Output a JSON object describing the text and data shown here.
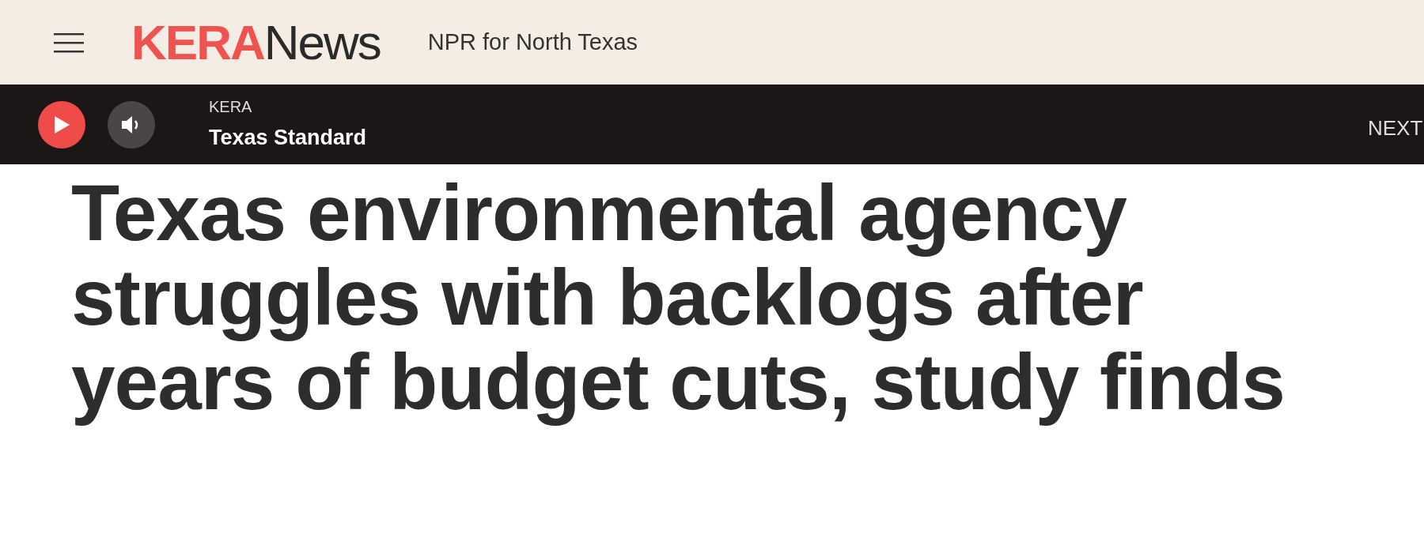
{
  "header": {
    "logo": {
      "part_1": "KERA",
      "part_2": "News"
    },
    "tagline": "NPR for North Texas"
  },
  "player": {
    "station": "KERA",
    "program": "Texas Standard",
    "next_label": "NEXT"
  },
  "article": {
    "headline": "Texas environmental agency struggles with backlogs after years of budget cuts, study finds"
  }
}
